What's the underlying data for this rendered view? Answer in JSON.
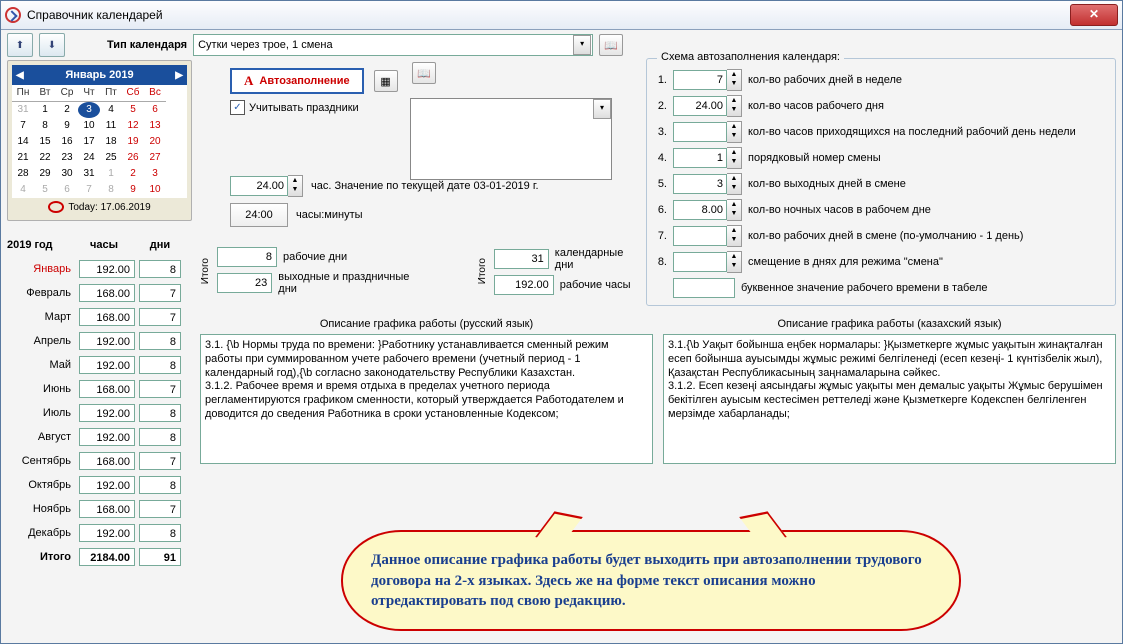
{
  "window": {
    "title": "Справочник календарей"
  },
  "toolbar": {
    "type_label": "Тип календаря",
    "type_value": "Сутки через трое, 1 смена"
  },
  "calendar": {
    "title": "Январь 2019",
    "dow": [
      "Пн",
      "Вт",
      "Ср",
      "Чт",
      "Пт",
      "Сб",
      "Вс"
    ],
    "weeks": [
      [
        {
          "d": "31",
          "dim": true
        },
        {
          "d": "1"
        },
        {
          "d": "2"
        },
        {
          "d": "3",
          "sel": true
        },
        {
          "d": "4"
        },
        {
          "d": "5",
          "we": true
        },
        {
          "d": "6",
          "we": true
        }
      ],
      [
        {
          "d": "7"
        },
        {
          "d": "8"
        },
        {
          "d": "9"
        },
        {
          "d": "10"
        },
        {
          "d": "11"
        },
        {
          "d": "12",
          "we": true
        },
        {
          "d": "13",
          "we": true
        }
      ],
      [
        {
          "d": "14"
        },
        {
          "d": "15"
        },
        {
          "d": "16"
        },
        {
          "d": "17"
        },
        {
          "d": "18"
        },
        {
          "d": "19",
          "we": true
        },
        {
          "d": "20",
          "we": true
        }
      ],
      [
        {
          "d": "21"
        },
        {
          "d": "22"
        },
        {
          "d": "23"
        },
        {
          "d": "24"
        },
        {
          "d": "25"
        },
        {
          "d": "26",
          "we": true
        },
        {
          "d": "27",
          "we": true
        }
      ],
      [
        {
          "d": "28"
        },
        {
          "d": "29"
        },
        {
          "d": "30"
        },
        {
          "d": "31"
        },
        {
          "d": "1",
          "dim": true
        },
        {
          "d": "2",
          "dim": true,
          "we": true
        },
        {
          "d": "3",
          "dim": true,
          "we": true
        }
      ],
      [
        {
          "d": "4",
          "dim": true
        },
        {
          "d": "5",
          "dim": true
        },
        {
          "d": "6",
          "dim": true
        },
        {
          "d": "7",
          "dim": true
        },
        {
          "d": "8",
          "dim": true
        },
        {
          "d": "9",
          "dim": true,
          "we": true
        },
        {
          "d": "10",
          "dim": true,
          "we": true
        }
      ]
    ],
    "today": "Today: 17.06.2019"
  },
  "year": {
    "header": "2019 год",
    "col_hours": "часы",
    "col_days": "дни",
    "rows": [
      {
        "m": "Январь",
        "h": "192.00",
        "d": "8",
        "sel": true
      },
      {
        "m": "Февраль",
        "h": "168.00",
        "d": "7"
      },
      {
        "m": "Март",
        "h": "168.00",
        "d": "7"
      },
      {
        "m": "Апрель",
        "h": "192.00",
        "d": "8"
      },
      {
        "m": "Май",
        "h": "192.00",
        "d": "8"
      },
      {
        "m": "Июнь",
        "h": "168.00",
        "d": "7"
      },
      {
        "m": "Июль",
        "h": "192.00",
        "d": "8"
      },
      {
        "m": "Август",
        "h": "192.00",
        "d": "8"
      },
      {
        "m": "Сентябрь",
        "h": "168.00",
        "d": "7"
      },
      {
        "m": "Октябрь",
        "h": "192.00",
        "d": "8"
      },
      {
        "m": "Ноябрь",
        "h": "168.00",
        "d": "7"
      },
      {
        "m": "Декабрь",
        "h": "192.00",
        "d": "8"
      }
    ],
    "total": {
      "m": "Итого",
      "h": "2184.00",
      "d": "91"
    }
  },
  "center": {
    "autofill": "Автозаполнение",
    "holidays_chk": "Учитывать праздники",
    "hours_val": "24.00",
    "hours_txt": "час. Значение по текущей дате 03-01-2019 г.",
    "time_val": "24:00",
    "time_txt": "часы:минуты",
    "itogo": "Итого",
    "work_days_v": "8",
    "work_days_l": "рабочие дни",
    "off_days_v": "23",
    "off_days_l": "выходные и праздничные дни",
    "cal_days_v": "31",
    "cal_days_l": "календарные дни",
    "work_h_v": "192.00",
    "work_h_l": "рабочие часы"
  },
  "desc": {
    "ru_head": "Описание графика работы (русский язык)",
    "kz_head": "Описание графика работы (казахский язык)",
    "ru_text": "3.1. {\\b Нормы труда по времени:  }Работнику устанавливается сменный режим работы при суммированном учете рабочего времени (учетный период - 1 календарный год),{\\b  согласно законодательству Республики Казахстан.\n3.1.2.  Рабочее время и время отдыха в пределах учетного периода регламентируются графиком сменности, который утверждается Работодателем и доводится до сведения Работника в сроки установленные Кодексом;",
    "kz_text": "3.1.{\\b  Уақыт бойынша еңбек нормалары:  }Қызметкерге жұмыс уақытын жинақталған есеп бойынша ауысымды жұмыс режимі белгіленеді (есеп кезеңі- 1 күнтізбелік жыл), Қазақстан Республикасының заңнамаларына сәйкес.\n3.1.2. Есеп кезеңі аясындағы жұмыс уақыты мен демалыс уақыты Жұмыс берушімен бекітілген ауысым кестесімен реттеледі және Қызметкерге Кодекспен белгіленген мерзімде хабарланады;"
  },
  "scheme": {
    "title": "Схема автозаполнения календаря:",
    "rows": [
      {
        "n": "1.",
        "v": "7",
        "l": "кол-во рабочих дней в неделе"
      },
      {
        "n": "2.",
        "v": "24.00",
        "l": "кол-во часов рабочего дня"
      },
      {
        "n": "3.",
        "v": "",
        "l": "кол-во часов приходящихся на последний рабочий день недели"
      },
      {
        "n": "4.",
        "v": "1",
        "l": "порядковый номер смены"
      },
      {
        "n": "5.",
        "v": "3",
        "l": "кол-во выходных дней в смене"
      },
      {
        "n": "6.",
        "v": "8.00",
        "l": "кол-во ночных часов в рабочем дне"
      },
      {
        "n": "7.",
        "v": "",
        "l": "кол-во рабочих дней в смене (по-умолчанию - 1 день)"
      },
      {
        "n": "8.",
        "v": "",
        "l": "смещение в днях для режима \"смена\""
      },
      {
        "n": "",
        "v": "",
        "l": "буквенное значение рабочего времени в табеле",
        "plain": true
      }
    ]
  },
  "note": "Данное описание графика работы будет выходить при автозаполнении трудового договора на 2-х языках. Здесь же на форме текст описания можно отредактировать под свою редакцию."
}
